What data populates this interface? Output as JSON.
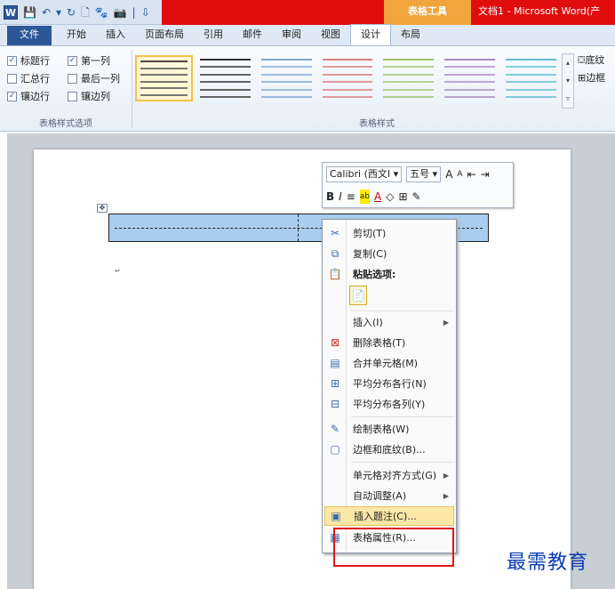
{
  "title_bar": {
    "quick_access": [
      "W",
      "💾",
      "↶",
      "▾",
      "↻",
      "🗋",
      "🐾",
      "📷",
      "|",
      "⇩"
    ],
    "context_tab": "表格工具",
    "document_title": "文档1 - Microsoft Word(产"
  },
  "ribbon_tabs": [
    "文件",
    "开始",
    "插入",
    "页面布局",
    "引用",
    "邮件",
    "审阅",
    "视图",
    "设计",
    "布局"
  ],
  "active_tab": "设计",
  "style_options": {
    "rows": [
      [
        {
          "label": "标题行",
          "checked": true
        },
        {
          "label": "第一列",
          "checked": true
        }
      ],
      [
        {
          "label": "汇总行",
          "checked": false
        },
        {
          "label": "最后一列",
          "checked": false
        }
      ],
      [
        {
          "label": "镶边行",
          "checked": true
        },
        {
          "label": "镶边列",
          "checked": false
        }
      ]
    ],
    "group_label": "表格样式选项"
  },
  "table_styles": {
    "group_label": "表格样式",
    "swatch_colors": [
      "#4a4a4a",
      "#333333",
      "#7fa7d6",
      "#d97c7c",
      "#9cc46a",
      "#a889c4",
      "#5fbcd3"
    ],
    "right_items": [
      "底纹",
      "边框"
    ]
  },
  "mini_toolbar": {
    "font": "Calibri (西文Ⅰ",
    "size": "五号",
    "row1_buttons": [
      "A",
      "A",
      "⇤",
      "⇥"
    ],
    "row2_buttons": [
      "B",
      "I",
      "≡",
      "ab",
      "A",
      "◇",
      "⊞",
      "✎"
    ]
  },
  "context_menu": {
    "items": [
      {
        "label": "剪切(T)",
        "icon": "scissors-icon",
        "glyph": "✂"
      },
      {
        "label": "复制(C)",
        "icon": "copy-icon",
        "glyph": "⧉"
      },
      {
        "label": "粘贴选项:",
        "icon": "paste-icon",
        "glyph": "📋"
      },
      {
        "label": "插入(I)",
        "icon": "",
        "glyph": "",
        "submenu": true
      },
      {
        "label": "删除表格(T)",
        "icon": "delete-table-icon",
        "glyph": "⊠"
      },
      {
        "label": "合并单元格(M)",
        "icon": "merge-cells-icon",
        "glyph": "▤"
      },
      {
        "label": "平均分布各行(N)",
        "icon": "distribute-rows-icon",
        "glyph": "⊞"
      },
      {
        "label": "平均分布各列(Y)",
        "icon": "distribute-columns-icon",
        "glyph": "⊟"
      },
      {
        "label": "绘制表格(W)",
        "icon": "draw-table-icon",
        "glyph": "✎"
      },
      {
        "label": "边框和底纹(B)...",
        "icon": "borders-icon",
        "glyph": "▢"
      },
      {
        "label": "单元格对齐方式(G)",
        "icon": "",
        "glyph": "",
        "submenu": true
      },
      {
        "label": "自动调整(A)",
        "icon": "",
        "glyph": "",
        "submenu": true
      },
      {
        "label": "插入题注(C)...",
        "icon": "insert-caption-icon",
        "glyph": "▣"
      },
      {
        "label": "表格属性(R)...",
        "icon": "table-properties-icon",
        "glyph": "▦"
      }
    ],
    "paste_option_glyph": "📄"
  },
  "watermark": "最需教育"
}
